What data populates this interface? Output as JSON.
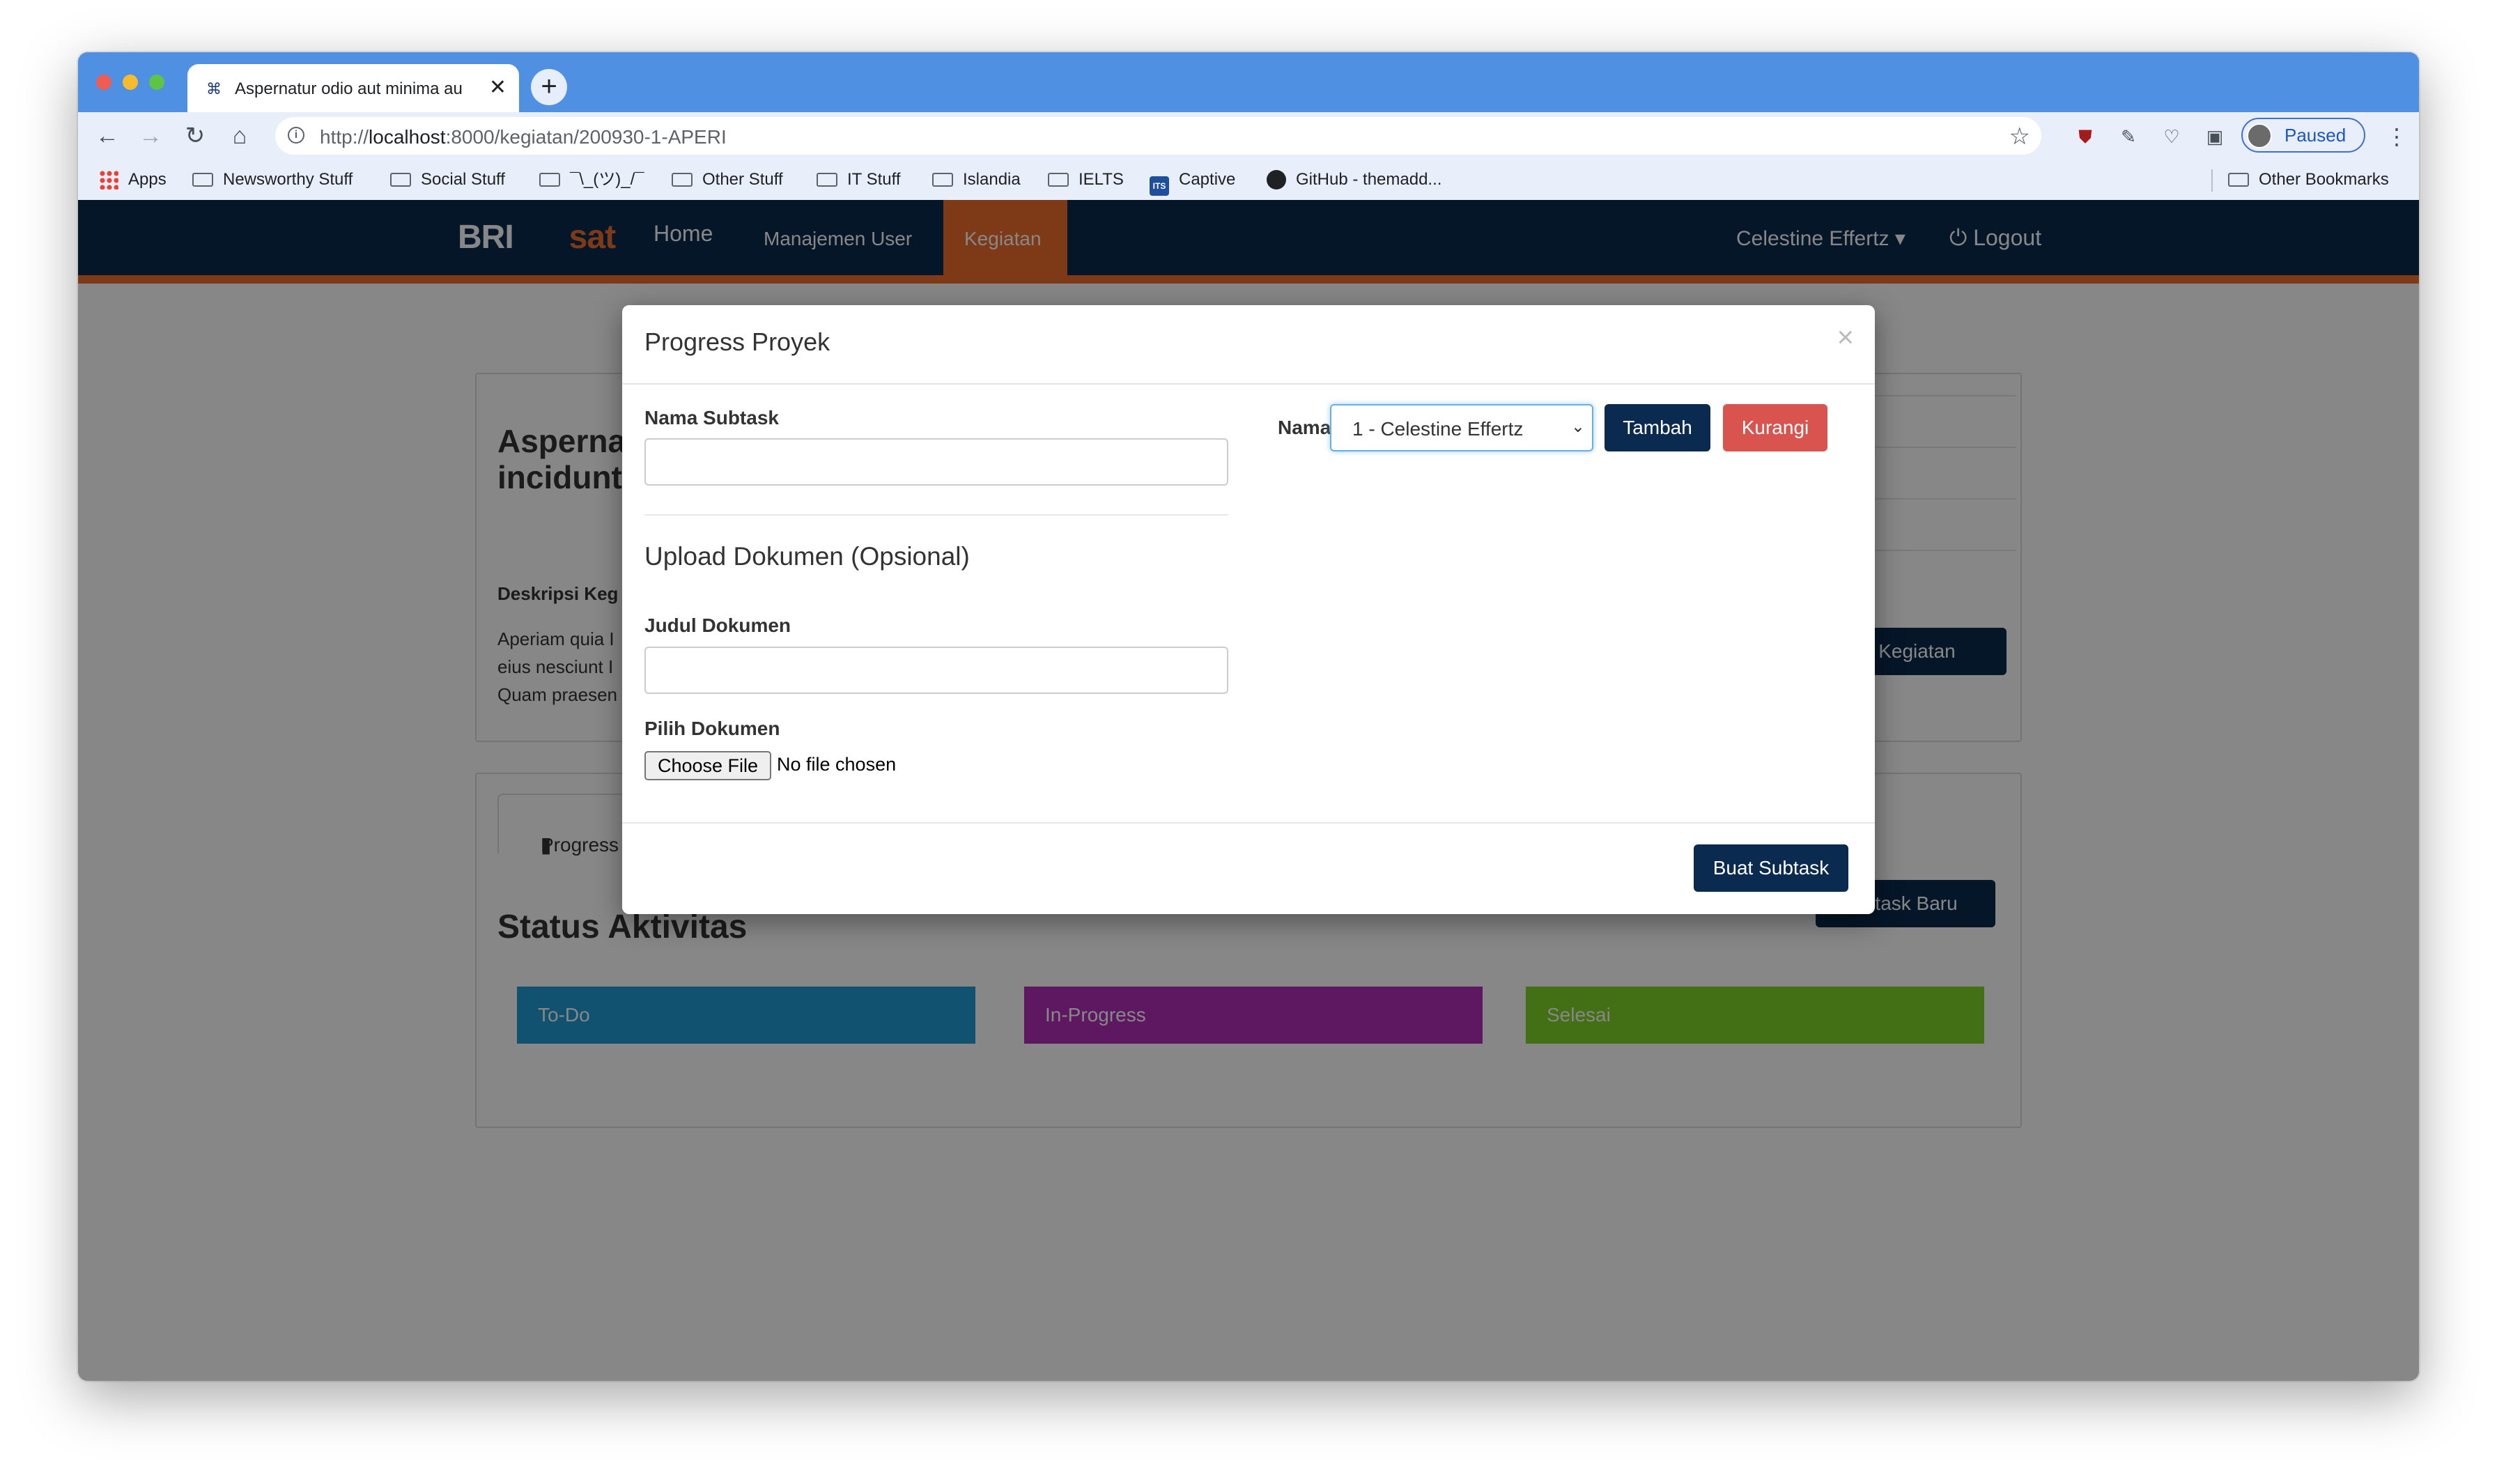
{
  "browser": {
    "tab_title": "Aspernatur odio aut minima au",
    "tab_close": "✕",
    "new_tab": "+",
    "url_prefix": "http://",
    "url_host": "localhost",
    "url_rest": ":8000/kegiatan/200930-1-APERI",
    "paused_label": "Paused",
    "bookmarks": [
      "Apps",
      "Newsworthy Stuff",
      "Social Stuff",
      "¯\\_(ツ)_/¯",
      "Other Stuff",
      "IT Stuff",
      "Islandia",
      "IELTS",
      "Captive",
      "GitHub - themadd...",
      "Other Bookmarks"
    ],
    "icons": [
      "back-icon",
      "forward-icon",
      "reload-icon",
      "home-icon",
      "info-icon",
      "star-icon",
      "ublock-icon",
      "extension-icon",
      "pocket-icon",
      "lock-icon",
      "camera-icon",
      "d-icon",
      "puzzle-icon",
      "menu-icon"
    ]
  },
  "app": {
    "brand_main": "BRI",
    "brand_accent": "sat",
    "nav_home": "Home",
    "nav_users": "Manajemen User",
    "nav_kegiatan": "Kegiatan",
    "user_menu": "Celestine Effertz",
    "logout": "Logout"
  },
  "background": {
    "title": "Asperna voluptat incidunt",
    "desc_label": "Deskripsi Keg",
    "desc_lines": [
      "Aperiam quia I",
      "eius nesciunt I",
      "Quam praesen"
    ],
    "edit_button": "ah Kegiatan",
    "tab_progress": "Progress",
    "status_title": "Status Aktivitas",
    "new_subtask_button": "ubtask Baru",
    "columns": [
      {
        "label": "To-Do",
        "color": "#1f9bd1"
      },
      {
        "label": "In-Progress",
        "color": "#b12fb8"
      },
      {
        "label": "Selesai",
        "color": "#7fd129"
      }
    ]
  },
  "modal": {
    "title": "Progress Proyek",
    "close": "×",
    "subtask_label": "Nama Subtask",
    "subtask_value": "",
    "upload_heading": "Upload Dokumen (Opsional)",
    "doc_title_label": "Judul Dokumen",
    "doc_title_value": "",
    "file_label": "Pilih Dokumen",
    "choose_file": "Choose File",
    "no_file": "No file chosen",
    "name_label": "Nama",
    "name_selected": "1 - Celestine Effertz",
    "add_button": "Tambah",
    "remove_button": "Kurangi",
    "submit_button": "Buat Subtask"
  }
}
